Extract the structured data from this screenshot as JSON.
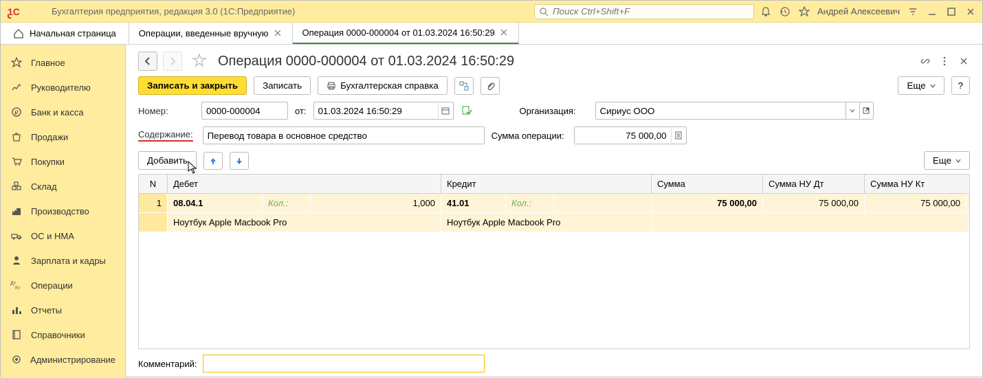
{
  "app": {
    "title": "Бухгалтерия предприятия, редакция 3.0  (1С:Предприятие)",
    "search_placeholder": "Поиск Ctrl+Shift+F",
    "user": "Андрей Алексеевич"
  },
  "tabs": {
    "home": "Начальная страница",
    "list": "Операции, введенные вручную",
    "doc": "Операция 0000-000004 от 01.03.2024 16:50:29"
  },
  "sidebar": {
    "items": [
      {
        "label": "Главное"
      },
      {
        "label": "Руководителю"
      },
      {
        "label": "Банк и касса"
      },
      {
        "label": "Продажи"
      },
      {
        "label": "Покупки"
      },
      {
        "label": "Склад"
      },
      {
        "label": "Производство"
      },
      {
        "label": "ОС и НМА"
      },
      {
        "label": "Зарплата и кадры"
      },
      {
        "label": "Операции"
      },
      {
        "label": "Отчеты"
      },
      {
        "label": "Справочники"
      },
      {
        "label": "Администрирование"
      }
    ]
  },
  "doc": {
    "title": "Операция 0000-000004 от 01.03.2024 16:50:29",
    "btn_save_close": "Записать и закрыть",
    "btn_save": "Записать",
    "btn_report": "Бухгалтерская справка",
    "btn_more": "Еще",
    "label_number": "Номер:",
    "value_number": "0000-000004",
    "label_from": "от:",
    "value_date": "01.03.2024 16:50:29",
    "label_org": "Организация:",
    "value_org": "Сириус ООО",
    "label_content": "Содержание:",
    "value_content": "Перевод товара в основное средство",
    "label_sum": "Сумма операции:",
    "value_sum": "75 000,00",
    "btn_add": "Добавить",
    "btn_more2": "Еще",
    "label_comment": "Комментарий:",
    "value_comment": ""
  },
  "grid": {
    "headers": {
      "n": "N",
      "debet": "Дебет",
      "kredit": "Кредит",
      "sum": "Сумма",
      "nudt": "Сумма НУ Дт",
      "nukt": "Сумма НУ Кт"
    },
    "row1": {
      "n": "1",
      "debet_acct": "08.04.1",
      "qty_label_d": "Кол.:",
      "debet_qty": "1,000",
      "kredit_acct": "41.01",
      "qty_label_k": "Кол.:",
      "sum": "75 000,00",
      "nudt": "75 000,00",
      "nukt": "75 000,00",
      "debet_detail": "Ноутбук Apple Macbook Pro",
      "kredit_detail": "Ноутбук Apple Macbook Pro"
    }
  }
}
